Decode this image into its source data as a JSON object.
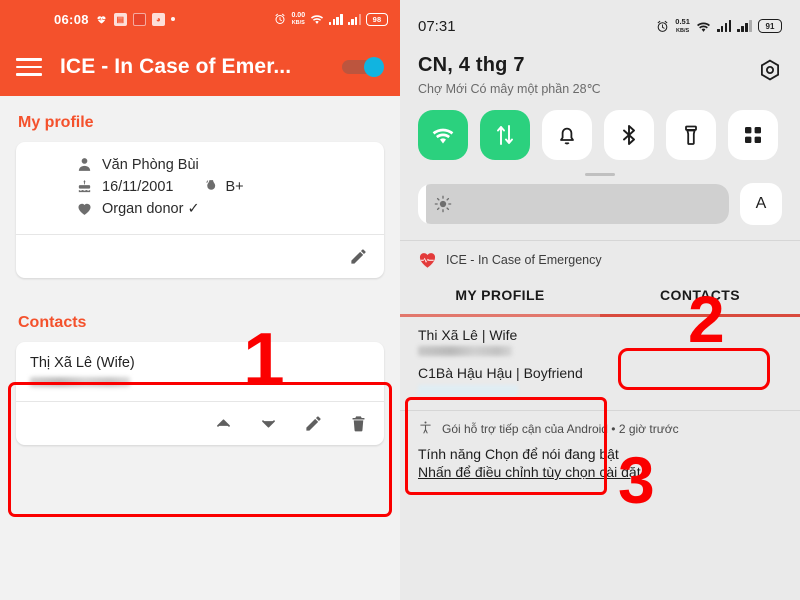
{
  "left": {
    "status_bar": {
      "time": "06:08",
      "net_speed": "0.00",
      "net_speed_unit": "KB/S",
      "battery": "98",
      "icons": [
        "heartbeat-icon",
        "image-icon",
        "video-icon",
        "panda-icon",
        "dot-icon",
        "alarm-icon",
        "wifi-icon",
        "signal-icon",
        "signal-icon-2",
        "battery-icon"
      ]
    },
    "app_bar": {
      "menu_icon": "hamburger-icon",
      "title": "ICE - In Case of Emer...",
      "toggle_state": "on"
    },
    "profile_section": {
      "title": "My profile",
      "name": "Văn Phòng Bùi",
      "birthday": "16/11/2001",
      "blood_type": "B+",
      "organ_donor": "Organ donor ✓",
      "edit_label": "edit-icon"
    },
    "contacts_section": {
      "title": "Contacts",
      "contact_name": "Thị Xã Lê (Wife)",
      "phone_redacted": "",
      "actions": [
        "move-up-icon",
        "move-down-icon",
        "edit-icon",
        "delete-icon"
      ]
    },
    "annotation_number": "1"
  },
  "right": {
    "status_bar": {
      "time": "07:31",
      "net_speed": "0.51",
      "net_speed_unit": "KB/S",
      "battery": "91"
    },
    "date_header": {
      "date": "CN, 4 thg 7",
      "weather": "Chợ Mới Có mây một phần 28℃",
      "settings_icon": "gear-icon"
    },
    "tiles": [
      {
        "name": "wifi-tile",
        "icon": "wifi-icon",
        "active": true
      },
      {
        "name": "mobile-data-tile",
        "icon": "data-arrows-icon",
        "active": true
      },
      {
        "name": "silent-tile",
        "icon": "bell-icon",
        "active": false
      },
      {
        "name": "bluetooth-tile",
        "icon": "bluetooth-icon",
        "active": false
      },
      {
        "name": "flashlight-tile",
        "icon": "flashlight-icon",
        "active": false
      },
      {
        "name": "more-tiles-tile",
        "icon": "grid-icon",
        "active": false
      }
    ],
    "brightness": {
      "icon": "brightness-icon",
      "auto_label": "A"
    },
    "ice_notification": {
      "app_name": "ICE - In Case of Emergency",
      "app_icon": "heart-pulse-icon",
      "tabs": [
        {
          "label": "MY PROFILE",
          "active": false
        },
        {
          "label": "CONTACTS",
          "active": true
        }
      ],
      "contacts": [
        {
          "name": "Thi Xã Lê | Wife",
          "phone_redacted": ""
        },
        {
          "name": "C1Bà Hậu  Hậu | Boyfriend",
          "phone_redacted": ""
        }
      ]
    },
    "android_notification": {
      "icon": "accessibility-icon",
      "meta": "Gói hỗ trợ tiếp cận của Android • 2 giờ trước",
      "title": "Tính năng Chọn để nói đang bật",
      "subtitle": "Nhấn để điều chỉnh tùy chọn cài đặt"
    },
    "annotation_numbers": {
      "tabs": "2",
      "contacts": "3"
    }
  },
  "colors": {
    "brand_orange": "#f4512c",
    "annotation_red": "#fb0000",
    "tile_green": "#2bd17e",
    "toggle_knob": "#11b4e0",
    "tab_underline": "#d94a3d"
  }
}
